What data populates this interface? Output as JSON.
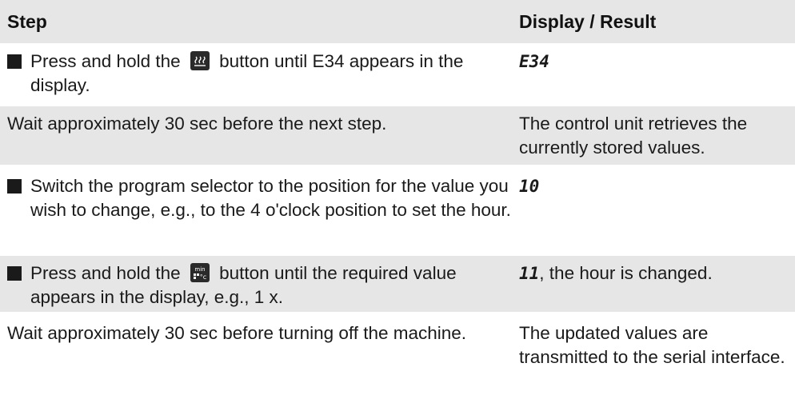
{
  "header": {
    "col_step": "Step",
    "col_result": "Display / Result"
  },
  "rows": [
    {
      "step_before": "Press and hold the",
      "step_icon": "heat-icon",
      "step_after": "button until E34 appears in the display.",
      "result_code": "E34",
      "result_text": ""
    },
    {
      "step_text": "Wait approximately 30 sec before the next step.",
      "result_text": "The control unit retrieves the currently stored values."
    },
    {
      "step_text": "Switch the program selector to the position for the value you wish to change, e.g., to the 4 o'clock position to set the hour.",
      "result_code": "10"
    },
    {
      "step_before": "Press and hold the",
      "step_icon": "min-celsius-icon",
      "step_after": "button until the required value appears in the display, e.g., 1 x.",
      "result_code": "11",
      "result_text": ", the hour is changed."
    },
    {
      "step_text": "Wait approximately 30 sec before turning off the machine.",
      "result_text": "The updated values are transmitted to the serial interface."
    }
  ]
}
